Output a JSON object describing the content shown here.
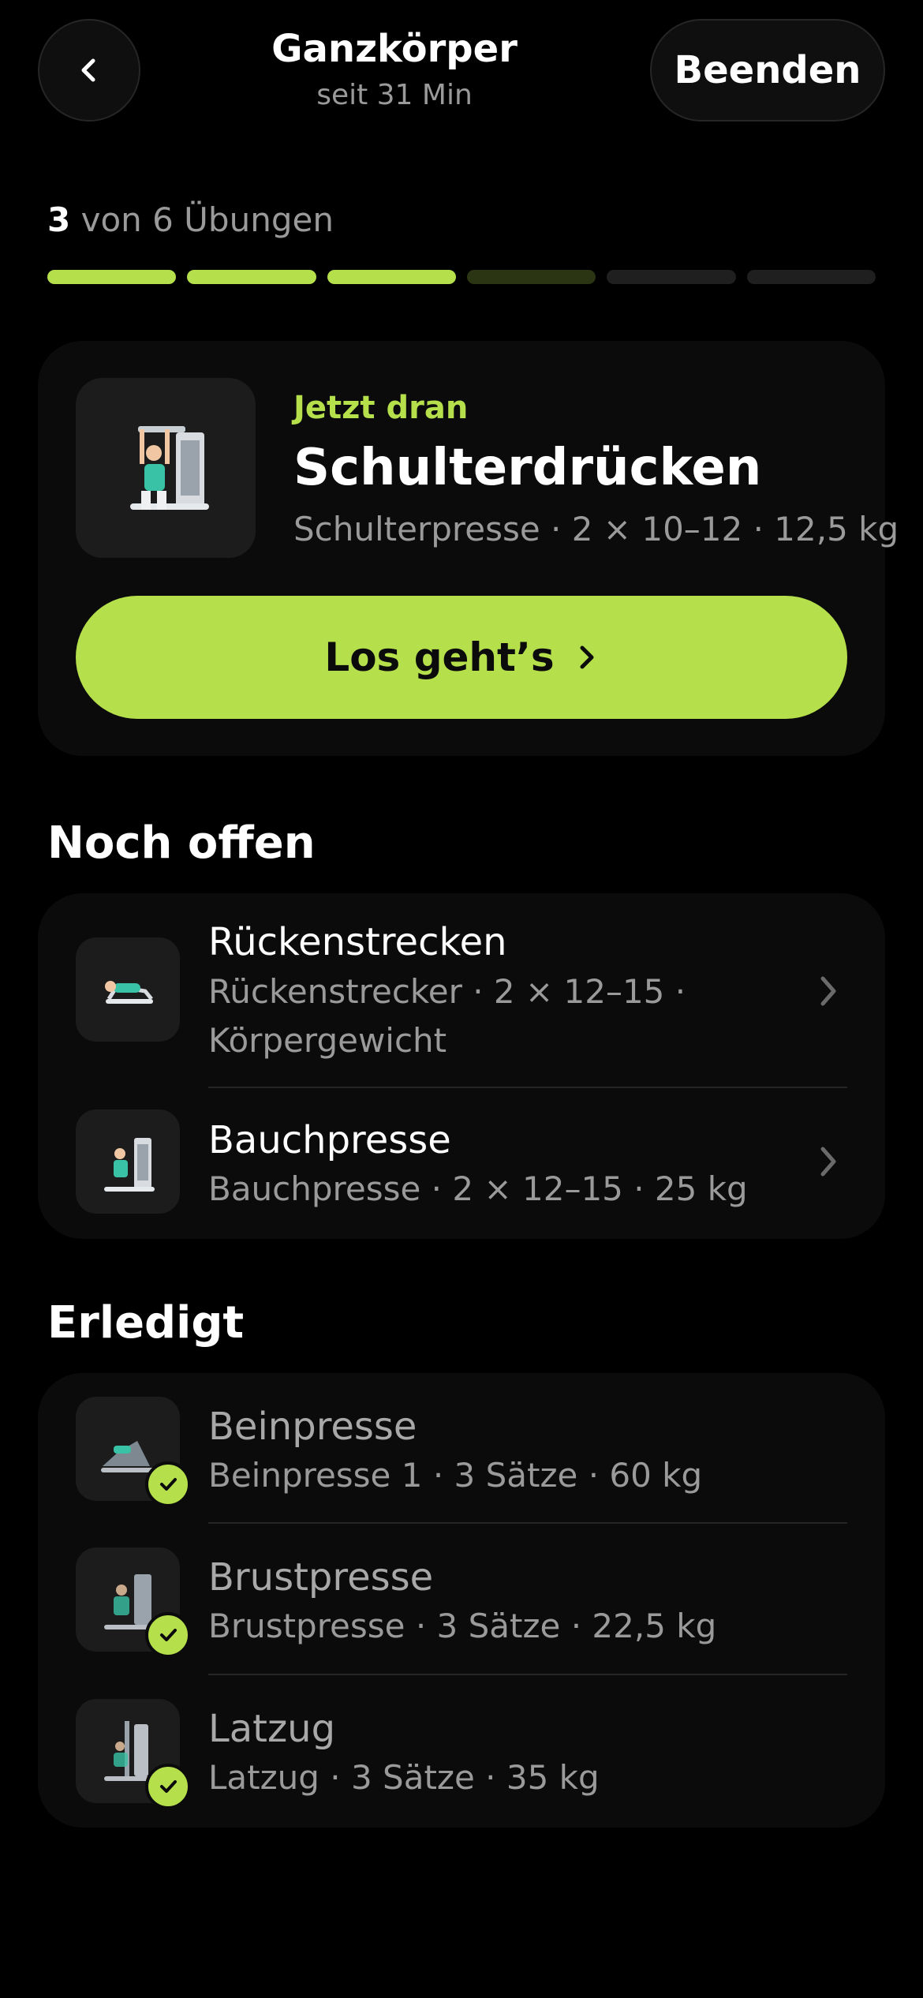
{
  "header": {
    "title": "Ganzkörper",
    "subtitle": "seit 31 Min",
    "end_label": "Beenden"
  },
  "progress": {
    "current": "3",
    "label_rest": " von 6 Übungen",
    "completed": 3,
    "total": 6
  },
  "current_exercise": {
    "label": "Jetzt dran",
    "title": "Schulterdrücken",
    "meta": "Schulterpresse · 2 × 10–12 · 12,5 kg",
    "button_label": "Los geht’s"
  },
  "open_section": {
    "title": "Noch offen",
    "items": [
      {
        "title": "Rückenstrecken",
        "meta_line1": "Rückenstrecker · 2 × 12–15 ·",
        "meta_line2": "Körpergewicht"
      },
      {
        "title": "Bauchpresse",
        "meta_line1": "Bauchpresse · 2 × 12–15 · 25 kg"
      }
    ]
  },
  "done_section": {
    "title": "Erledigt",
    "items": [
      {
        "title": "Beinpresse",
        "meta": "Beinpresse 1 · 3 Sätze · 60 kg"
      },
      {
        "title": "Brustpresse",
        "meta": "Brustpresse · 3 Sätze · 22,5 kg"
      },
      {
        "title": "Latzug",
        "meta": "Latzug · 3 Sätze · 35 kg"
      }
    ]
  },
  "colors": {
    "accent": "#b5e04b",
    "background": "#000000",
    "card": "#0b0b0b"
  },
  "icons": [
    "chevron-left-icon",
    "chevron-right-icon",
    "check-icon",
    "machine-illustration"
  ]
}
